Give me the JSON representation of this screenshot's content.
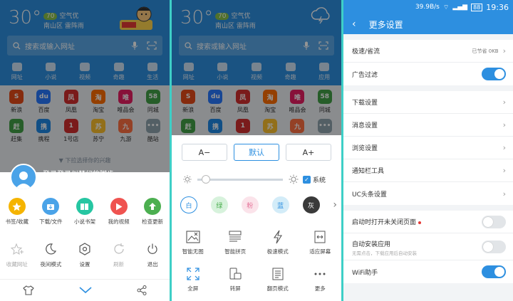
{
  "home": {
    "temp": "30°",
    "aqi_value": "70",
    "aqi_label": "空气优",
    "location": "南山区  雷阵雨",
    "search_placeholder": "搜索或输入网址",
    "categories": [
      "网址",
      "小说",
      "视频",
      "奇趣",
      "生活"
    ],
    "categories_alt": [
      "网址",
      "小说",
      "视频",
      "奇趣",
      "应用"
    ],
    "sites": [
      {
        "label": "新浪",
        "color": "#e64a19",
        "glyph": "S"
      },
      {
        "label": "百度",
        "color": "#2979ff",
        "glyph": "du"
      },
      {
        "label": "凤凰",
        "color": "#d32f2f",
        "glyph": "凤"
      },
      {
        "label": "淘宝",
        "color": "#ff6d00",
        "glyph": "淘"
      },
      {
        "label": "唯品会",
        "color": "#e91e63",
        "glyph": "唯"
      },
      {
        "label": "同城",
        "color": "#43a047",
        "glyph": "58"
      },
      {
        "label": "赶集",
        "color": "#43a047",
        "glyph": "赶"
      },
      {
        "label": "携程",
        "color": "#1e88e5",
        "glyph": "携"
      },
      {
        "label": "1号店",
        "color": "#d32f2f",
        "glyph": "1"
      },
      {
        "label": "苏宁",
        "color": "#fbc02d",
        "glyph": "苏"
      },
      {
        "label": "九游",
        "color": "#ff7043",
        "glyph": "九"
      },
      {
        "label": "酷站",
        "color": "#90a4ae",
        "glyph": "•••"
      }
    ],
    "hint": "下拉选择你的兴趣"
  },
  "menu": {
    "login_text": "登录登录似梦幻的脚步~",
    "row1": [
      {
        "label": "书签/收藏",
        "icon": "star-icon",
        "color": "#f5b400"
      },
      {
        "label": "下载/文件",
        "icon": "download-icon",
        "color": "#4aa3e8"
      },
      {
        "label": "小说书架",
        "icon": "book-icon",
        "color": "#26c6a2"
      },
      {
        "label": "我的视频",
        "icon": "play-icon",
        "color": "#ef5350"
      },
      {
        "label": "检查更新",
        "icon": "update-icon",
        "color": "#4caf50"
      }
    ],
    "row2": [
      {
        "label": "收藏网址",
        "icon": "bookmark-add-icon",
        "off": true
      },
      {
        "label": "夜间模式",
        "icon": "moon-icon",
        "off": false
      },
      {
        "label": "设置",
        "icon": "gear-icon",
        "off": false
      },
      {
        "label": "刷新",
        "icon": "refresh-icon",
        "off": true
      },
      {
        "label": "退出",
        "icon": "power-icon",
        "off": false
      }
    ]
  },
  "display": {
    "font_minus": "A−",
    "font_default": "默认",
    "font_plus": "A+",
    "system_label": "系统",
    "brightness": 0.06,
    "themes": [
      {
        "label": "白",
        "bg": "#ffffff",
        "fg": "#2d8fe0",
        "border": "#2d8fe0"
      },
      {
        "label": "绿",
        "bg": "#d7f2dc",
        "fg": "#4caf50",
        "border": "#d7f2dc"
      },
      {
        "label": "粉",
        "bg": "#fbe3ea",
        "fg": "#e57399",
        "border": "#fbe3ea"
      },
      {
        "label": "蓝",
        "bg": "#d3ecf8",
        "fg": "#2d8fe0",
        "border": "#d3ecf8"
      },
      {
        "label": "灰",
        "bg": "#3a3a3a",
        "fg": "#ffffff",
        "border": "#3a3a3a"
      }
    ],
    "tools_row1": [
      "智能无图",
      "智能拼页",
      "极速模式",
      "适应屏幕"
    ],
    "tools_row2": [
      "全屏",
      "转屏",
      "翻页模式",
      "更多"
    ]
  },
  "settings": {
    "status": {
      "speed": "39.9B/s",
      "battery": "88",
      "time": "19:36"
    },
    "title": "更多设置",
    "speed_row": {
      "label": "极速/省流",
      "value": "已节省 0KB"
    },
    "adblock": {
      "label": "广告过滤",
      "on": true
    },
    "nav": [
      "下载设置",
      "消息设置",
      "浏览设置",
      "通知栏工具",
      "UC头条设置"
    ],
    "restore": {
      "label": "启动时打开未关闭页面",
      "on": false
    },
    "autoinstall": {
      "label": "自动安装应用",
      "sub": "无需点击，下载应用后自动安装",
      "on": false
    },
    "wifi": {
      "label": "WiFi助手",
      "on": true
    }
  }
}
